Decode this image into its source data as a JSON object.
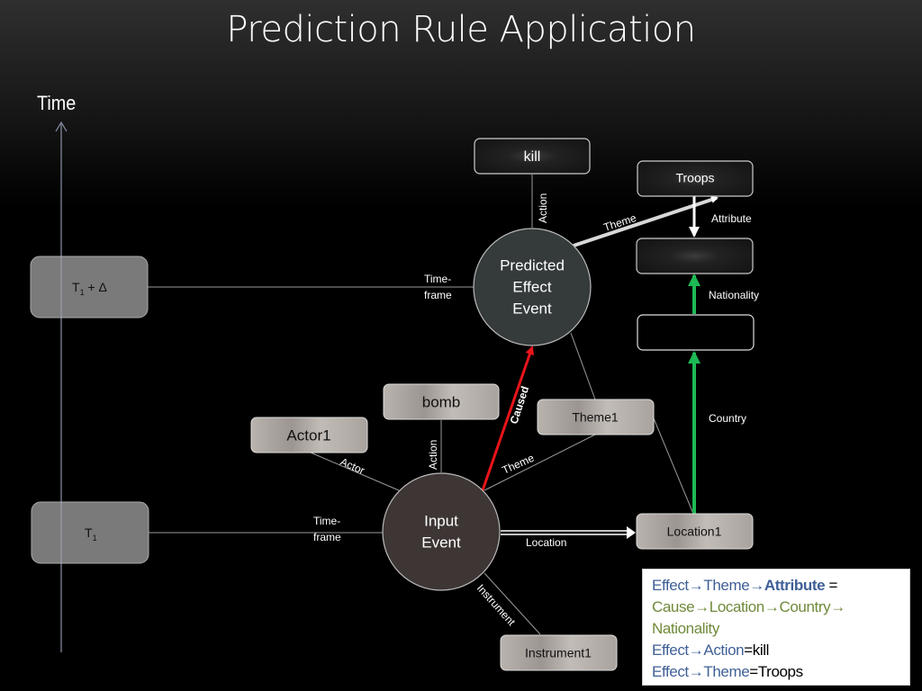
{
  "title": "Prediction Rule Application",
  "time_axis": {
    "label": "Time"
  },
  "time_boxes": {
    "t1_delta": {
      "main": "T",
      "sub": "1",
      "suffix": " + Δ"
    },
    "t1": {
      "main": "T",
      "sub": "1"
    }
  },
  "events": {
    "predicted": {
      "lines": [
        "Predicted",
        "Effect",
        "Event"
      ]
    },
    "input": {
      "lines": [
        "Input",
        "Event"
      ]
    }
  },
  "nodes": {
    "kill": "kill",
    "troops": "Troops",
    "attribute_box": "",
    "country_box": "",
    "bomb": "bomb",
    "actor1": "Actor1",
    "theme1": "Theme1",
    "location1": "Location1",
    "instrument1": "Instrument1"
  },
  "edge_labels": {
    "action_top": "Action",
    "theme_top": "Theme",
    "attribute": "Attribute",
    "nationality": "Nationality",
    "timeframe_top": [
      "Time-",
      "frame"
    ],
    "timeframe_bottom": [
      "Time-",
      "frame"
    ],
    "caused": "Caused",
    "action_bottom": "Action",
    "actor": "Actor",
    "theme_bottom": "Theme",
    "country": "Country",
    "location": "Location",
    "instrument": "Instrument"
  },
  "colors": {
    "caused_edge": "#e8141a",
    "green_edge": "#1db954",
    "rule_blue": "#3f5f96",
    "rule_green": "#6f8a3a"
  },
  "rule": {
    "line1": {
      "a": "Effect",
      "arrow1": "→",
      "b": "Theme",
      "arrow2": "→",
      "c": "Attribute",
      "d": " ="
    },
    "line2": {
      "a": "Cause",
      "arrow1": "→",
      "b": "Location",
      "arrow2": "→",
      "c": "Country",
      "arrow3": "→"
    },
    "line3": {
      "a": "Nationality"
    },
    "line4": {
      "a": "Effect",
      "arrow1": "→",
      "b": "Action",
      "c": "=kill"
    },
    "line5": {
      "a": "Effect",
      "arrow1": "→",
      "b": "Theme",
      "c": "=Troops"
    }
  }
}
